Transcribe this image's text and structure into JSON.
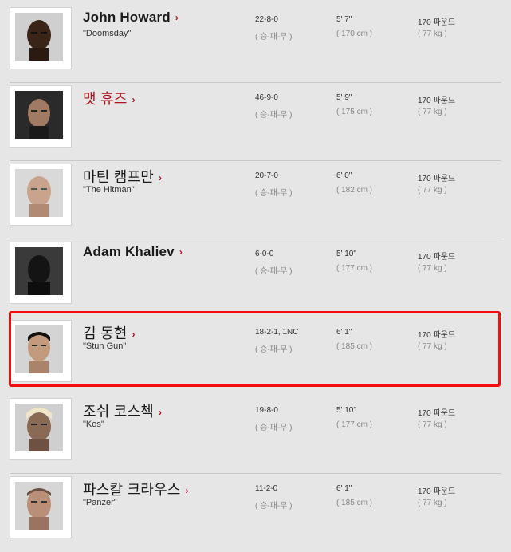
{
  "fighters": [
    {
      "name": "John Howard",
      "nick": "\"Doomsday\"",
      "record": "22-8-0",
      "record_label": "( 승-패-무 )",
      "height": "5' 7\"",
      "height_cm": "( 170 cm )",
      "weight": "170 파운드",
      "weight_kg": "( 77 kg )"
    },
    {
      "name": "맷 휴즈",
      "nick": "",
      "record": "46-9-0",
      "record_label": "( 승-패-무 )",
      "height": "5' 9\"",
      "height_cm": "( 175 cm )",
      "weight": "170 파운드",
      "weight_kg": "( 77 kg )"
    },
    {
      "name": "마틴 캠프만",
      "nick": "\"The Hitman\"",
      "record": "20-7-0",
      "record_label": "( 승-패-무 )",
      "height": "6' 0\"",
      "height_cm": "( 182 cm )",
      "weight": "170 파운드",
      "weight_kg": "( 77 kg )"
    },
    {
      "name": "Adam Khaliev",
      "nick": "",
      "record": "6-0-0",
      "record_label": "( 승-패-무 )",
      "height": "5' 10\"",
      "height_cm": "( 177 cm )",
      "weight": "170 파운드",
      "weight_kg": "( 77 kg )"
    },
    {
      "name": "김 동현",
      "nick": "\"Stun Gun\"",
      "record": "18-2-1, 1NC",
      "record_label": "( 승-패-무 )",
      "height": "6' 1\"",
      "height_cm": "( 185 cm )",
      "weight": "170 파운드",
      "weight_kg": "( 77 kg )"
    },
    {
      "name": "조쉬 코스첵",
      "nick": "\"Kos\"",
      "record": "19-8-0",
      "record_label": "( 승-패-무 )",
      "height": "5' 10\"",
      "height_cm": "( 177 cm )",
      "weight": "170 파운드",
      "weight_kg": "( 77 kg )"
    },
    {
      "name": "파스칼 크라우스",
      "nick": "\"Panzer\"",
      "record": "11-2-0",
      "record_label": "( 승-패-무 )",
      "height": "6' 1\"",
      "height_cm": "( 185 cm )",
      "weight": "170 파운드",
      "weight_kg": "( 77 kg )"
    }
  ],
  "arrow_glyph": "›",
  "colors": {
    "name_link_red": "#b3111b",
    "highlight_border": "#f30d0d",
    "background": "#e6e6e6"
  },
  "highlighted_fighter": "김 동현"
}
